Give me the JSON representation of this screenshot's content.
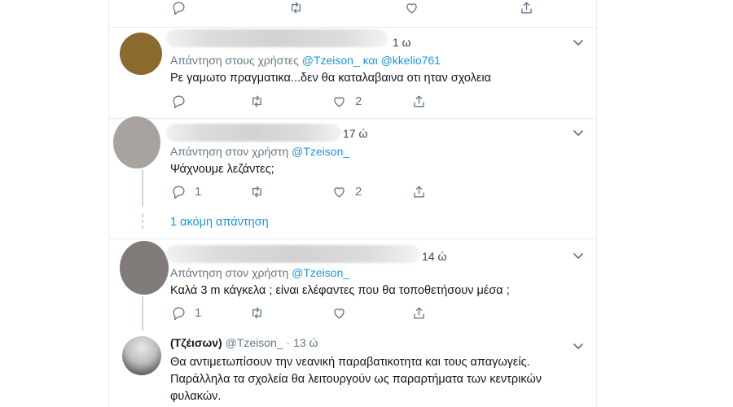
{
  "top_actions": {
    "reply_icon": "reply-icon",
    "retweet_icon": "retweet-icon",
    "like_icon": "heart-icon",
    "share_icon": "share-icon"
  },
  "tweets": [
    {
      "time": "1 ω",
      "replying_prefix": "Απάντηση στους χρήστες",
      "mention1": "@Tzeison_",
      "conj": "και",
      "mention2": "@kkelio761",
      "text": "Ρε γαμωτο πραγματικα...δεν θα καταλαβαινα οτι ηταν σχολεια",
      "reply_count": "",
      "retweet_count": "",
      "like_count": "2",
      "avatar_color": "#8a6a2e"
    },
    {
      "time": "17 ώ",
      "replying_prefix": "Απάντηση στον χρήστη",
      "mention1": "@Tzeison_",
      "text": "Ψάχνουμε λεζάντες;",
      "reply_count": "1",
      "retweet_count": "",
      "like_count": "2",
      "avatar_color": "#a9a3a0"
    },
    {
      "time": "14 ώ",
      "replying_prefix": "Απάντηση στον χρήστη",
      "mention1": "@Tzeison_",
      "text": "Καλά 3 m κάγκελα ; είναι ελέφαντες που θα τοποθετήσουν μέσα ;",
      "reply_count": "1",
      "retweet_count": "",
      "like_count": "",
      "avatar_color": "#807b79"
    },
    {
      "display_name": "(Τζέισων)",
      "handle": "@Tzeison_",
      "separator": "·",
      "time": "13 ώ",
      "text_line1": "Θα αντιμετωπίσουν την νεανική παραβατικοτητα και τους απαγωγείς.",
      "text_line2": "Παράλληλα τα σχολεία θα λειτουργούν ως παραρτήματα των κεντρικών",
      "text_line3": "φυλακών."
    }
  ],
  "more_replies": "1 ακόμη απάντηση",
  "colors": {
    "link": "#1b95e0",
    "muted": "#657786",
    "border": "#e6ecf0"
  }
}
